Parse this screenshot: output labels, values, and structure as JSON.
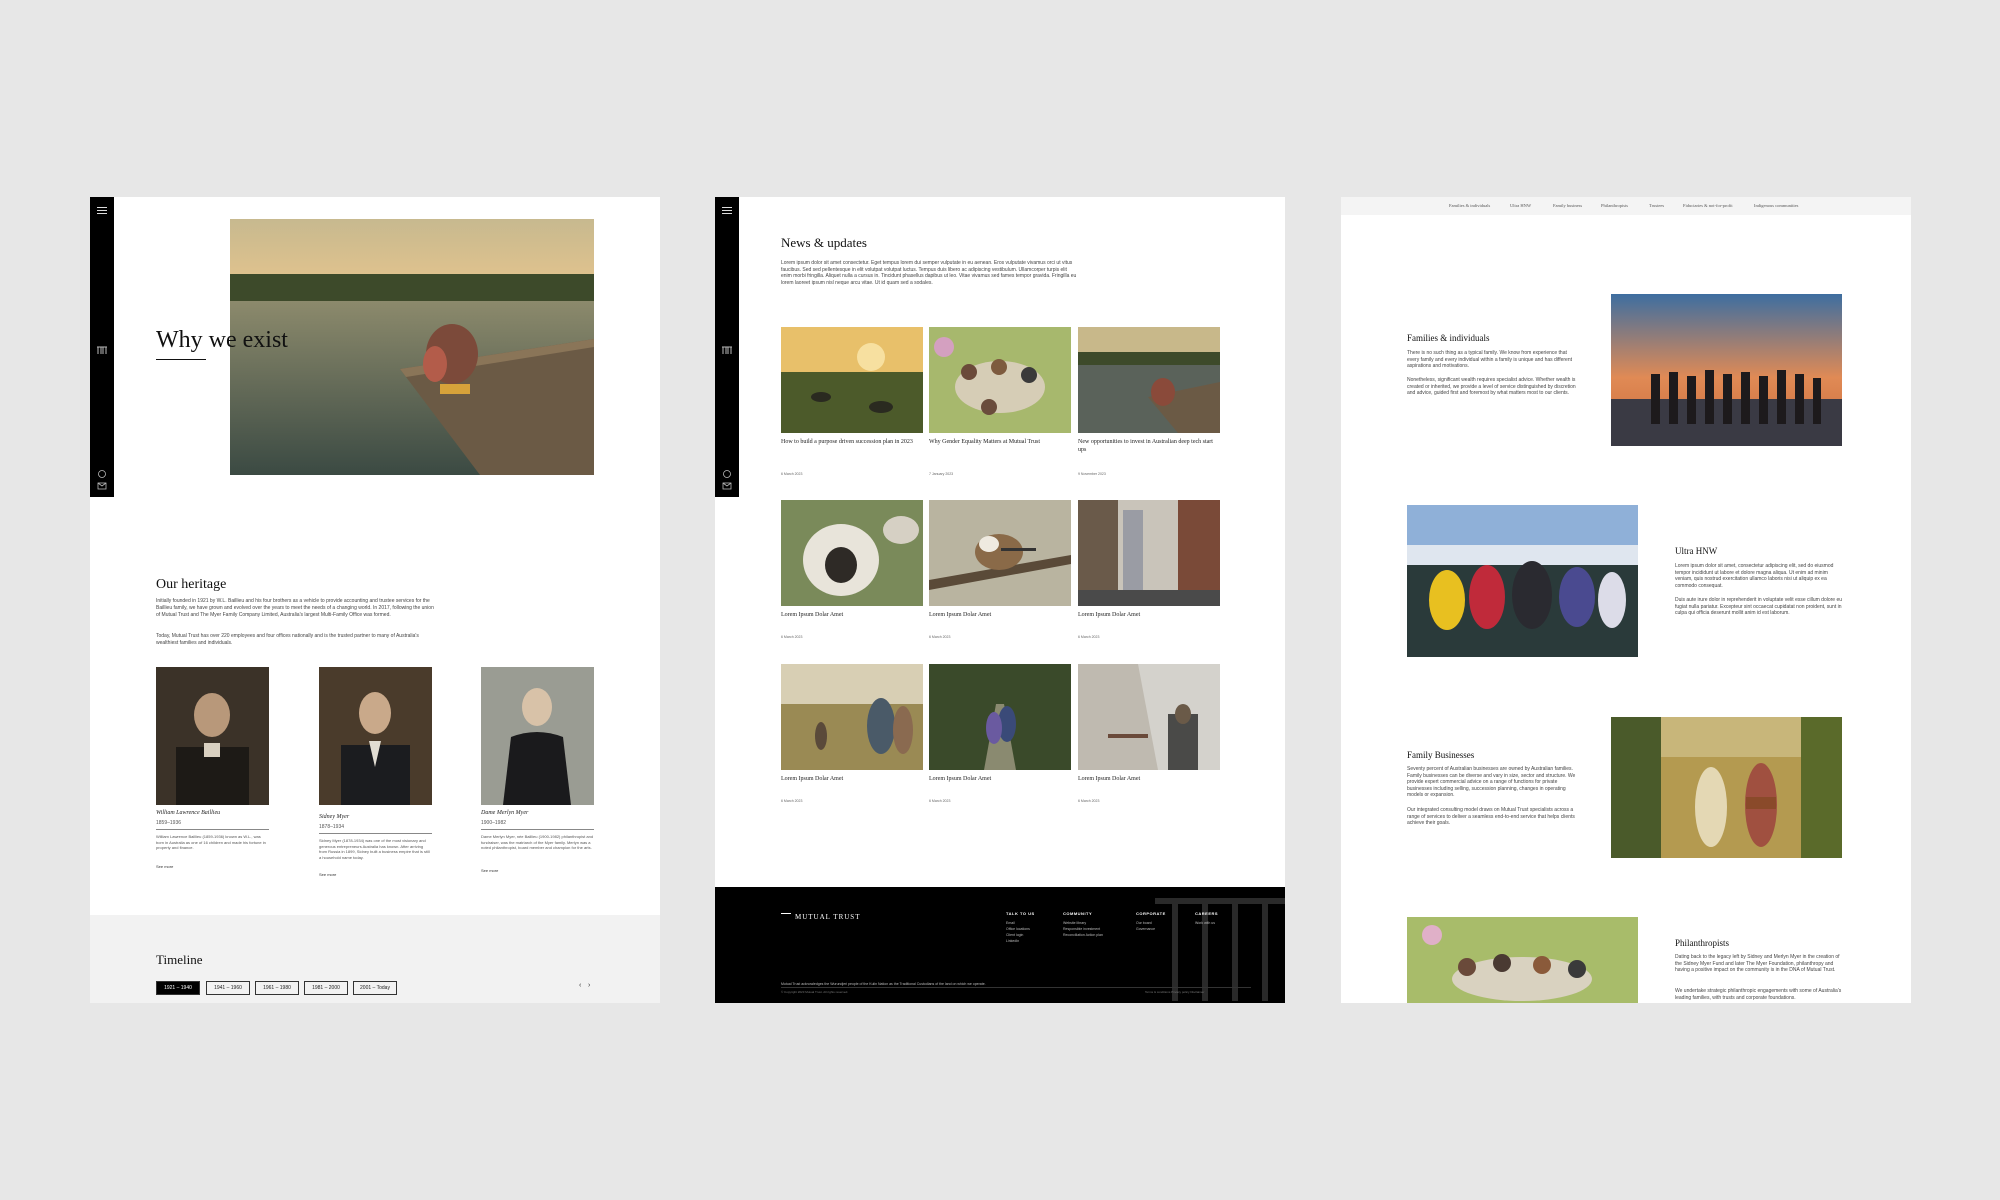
{
  "panel1": {
    "title": "Why we exist",
    "heritage": {
      "heading": "Our heritage",
      "para1": "Initially founded in 1921 by W.L. Baillieu and his four brothers as a vehicle to provide accounting and trustee services for the Baillieu family, we have grown and evolved over the years to meet the needs of a changing world. In 2017, following the union of Mutual Trust and The Myer Family Company Limited, Australia's largest Multi-Family Office was formed.",
      "para2": "Today, Mutual Trust has over 220 employees and four offices nationally and is the trusted partner to many of Australia's wealthiest families and individuals."
    },
    "people": [
      {
        "name": "William Lawrence Baillieu",
        "years": "1859–1936",
        "bio": "William Lawrence Baillieu (1859-1936) known as W.L., was born in Australia as one of 16 children and made his fortune in property and finance.",
        "more": "See more"
      },
      {
        "name": "Sidney Myer",
        "years": "1878–1934",
        "bio": "Sidney Myer (1878-1934) was one of the most visionary and generous entrepreneurs Australia has known. After arriving from Russia in 1899, Sidney built a business empire that is still a household name today.",
        "more": "See more"
      },
      {
        "name": "Dame Merlyn Myer",
        "years": "1900–1982",
        "bio": "Dame Merlyn Myer, née Baillieu (1900-1982) philanthropist and fundraiser, was the matriarch of the Myer family. Merlyn was a noted philanthropist, board member and champion for the arts.",
        "more": "See more"
      }
    ],
    "timeline": {
      "heading": "Timeline",
      "buttons": [
        "1921 – 1940",
        "1941 – 1960",
        "1961 – 1980",
        "1981 – 2000",
        "2001 – Today"
      ],
      "prev": "‹",
      "next": "›"
    }
  },
  "panel2": {
    "title": "News & updates",
    "intro": "Lorem ipsum dolor sit amet consectetur. Eget tempus lorem dui semper vulputate in eu aenean. Eros vulputate vivamus orci ut vitus faucibus. Sed sed pellentesque in elit volutpat volutpat luctus. Tempus duis libero ac adipiscing vestibulum. Ullamcorper turpis elit enim morbi fringilla. Aliquet nulla a cursus in. Tincidunt phasellus dapibus ut leo. Vitae vivamus sed fames tempor gravida. Fringilla eu lorem laoreet ipsum nisl neque arcu vitae. Ut id quam sed a sodales.",
    "cards": [
      {
        "title": "How to build a purpose driven succession plan in 2023",
        "date": "6 March 2023"
      },
      {
        "title": "Why Gender Equality Matters at Mutual Trust",
        "date": "7 January 2023"
      },
      {
        "title": "New opportunities to invest in Australian deep tech start ups",
        "date": "9 November 2023"
      },
      {
        "title": "Lorem Ipsum Dolar Amet",
        "date": "6 March 2023"
      },
      {
        "title": "Lorem Ipsum Dolar Amet",
        "date": "6 March 2023"
      },
      {
        "title": "Lorem Ipsum Dolar Amet",
        "date": "6 March 2023"
      },
      {
        "title": "Lorem Ipsum Dolar Amet",
        "date": "6 March 2023"
      },
      {
        "title": "Lorem Ipsum Dolar Amet",
        "date": "6 March 2023"
      },
      {
        "title": "Lorem Ipsum Dolar Amet",
        "date": "6 March 2023"
      }
    ],
    "footer": {
      "brand": "MUTUAL TRUST",
      "columns": [
        {
          "heading": "TALK TO US",
          "links": [
            "Email",
            "Office locations",
            "Client login",
            "LinkedIn"
          ]
        },
        {
          "heading": "COMMUNITY",
          "links": [
            "Website library",
            "Responsible investment",
            "Reconciliation Action plan"
          ]
        },
        {
          "heading": "CORPORATE",
          "links": [
            "Our board",
            "Governance"
          ]
        },
        {
          "heading": "CAREERS",
          "links": [
            "Work with us"
          ]
        }
      ],
      "acknowledgement": "Mutual Trust acknowledges the Wurundjeri people of the Kulin Nation as the Traditional Custodians of the land on which we operate.",
      "copyright": "© Copyright 2023 Mutual Trust. All rights reserved.",
      "legal": "Terms & conditions     Privacy policy     Disclaimer"
    }
  },
  "panel3": {
    "nav": [
      "Families & individuals",
      "Ultra HNW",
      "Family business",
      "Philanthropists",
      "Trustees",
      "Fiduciaries & not-for-profit",
      "Indigenous communities"
    ],
    "segments": [
      {
        "title": "Families & individuals",
        "p1": "There is no such thing as a typical family. We know from experience that every family and every individual within a family is unique and has different aspirations and motivations.",
        "p2": "Nonetheless, significant wealth requires specialist advice. Whether wealth is created or inherited, we provide a level of service distinguished by discretion and advice, guided first and foremost by what matters most to our clients."
      },
      {
        "title": "Ultra HNW",
        "p1": "Lorem ipsum dolor sit amet, consectetur adipiscing elit, sed do eiusmod tempor incididunt ut labore et dolore magna aliqua. Ut enim ad minim veniam, quis nostrud exercitation ullamco laboris nisi ut aliquip ex ea commodo consequat.",
        "p2": "Duis aute irure dolor in reprehenderit in voluptate velit esse cillum dolore eu fugiat nulla pariatur. Excepteur sint occaecat cupidatat non proident, sunt in culpa qui officia deserunt mollit anim id est laborum."
      },
      {
        "title": "Family Businesses",
        "p1": "Seventy percent of Australian businesses are owned by Australian families. Family businesses can be diverse and vary in size, sector and structure. We provide expert commercial advice on a range of functions for private businesses including selling, succession planning, changes in operating models or expansion.",
        "p2": "Our integrated consulting model draws on Mutual Trust specialists across a range of services to deliver a seamless end-to-end service that helps clients achieve their goals."
      },
      {
        "title": "Philanthropists",
        "p1": "Dating back to the legacy left by Sidney and Merlyn Myer in the creation of the Sidney Myer Fund and later The Myer Foundation, philanthropy and having a positive impact on the community is in the DNA of Mutual Trust.",
        "p2": "We undertake strategic philanthropic engagements with some of Australia's leading families, with trusts and corporate foundations."
      }
    ]
  }
}
